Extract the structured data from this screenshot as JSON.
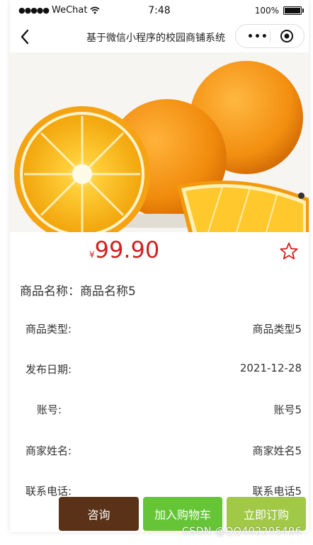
{
  "status_bar": {
    "carrier": "WeChat",
    "time": "7:48",
    "battery": "100%"
  },
  "nav": {
    "title": "基于微信小程序的校园商铺系统",
    "more_label": "•••"
  },
  "product": {
    "currency": "¥",
    "price": "99.90",
    "name_label": "商品名称：",
    "name": "商品名称5"
  },
  "details": [
    {
      "label": "商品类型:",
      "value": "商品类型5"
    },
    {
      "label": "发布日期:",
      "value": "2021-12-28"
    },
    {
      "label": "账号:",
      "value": "账号5"
    },
    {
      "label": "商家姓名:",
      "value": "商家姓名5"
    },
    {
      "label": "联系电话:",
      "value": "联系电话5"
    }
  ],
  "actions": {
    "consult": "咨询",
    "add_cart": "加入购物车",
    "buy_now": "立即订购"
  },
  "watermark": "CSDN @QQ402205496",
  "colors": {
    "price": "#d31f1f",
    "consult_button": "#5a3218",
    "cart_button": "#66c536",
    "buy_button": "#a2c848"
  },
  "icons": {
    "back": "chevron-left-icon",
    "menu": "more-dots-icon",
    "close": "target-circle-icon",
    "favorite": "star-outline-icon"
  }
}
